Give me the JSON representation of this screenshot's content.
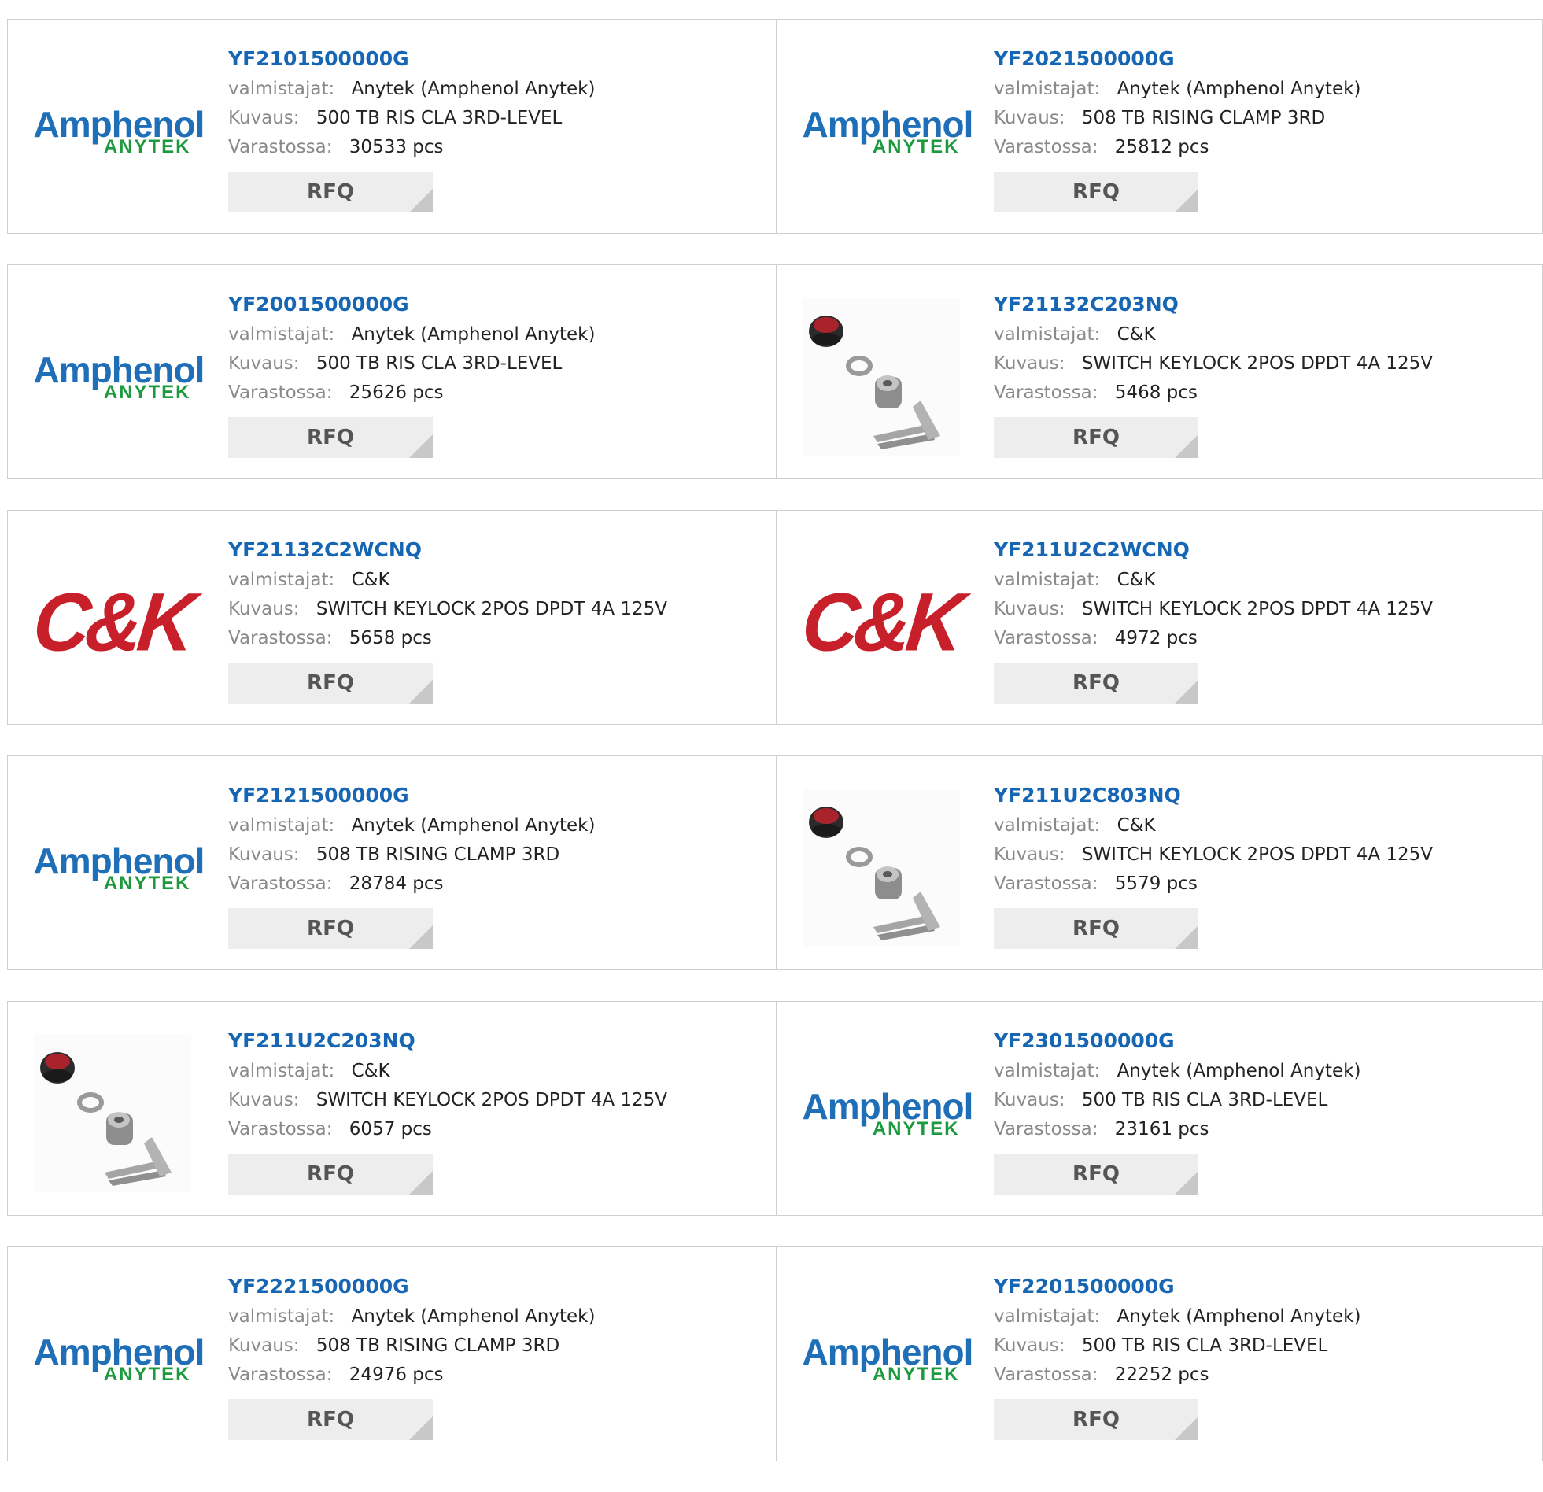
{
  "labels": {
    "manufacturer": "valmistajat:",
    "description": "Kuvaus:",
    "stock": "Varastossa:",
    "rfq": "RFQ"
  },
  "brands": {
    "amphenol": {
      "top": "Amphenol",
      "bottom": "ANYTEK"
    },
    "ck": {
      "text": "C&K"
    }
  },
  "colors": {
    "part_link": "#1766b4",
    "amphenol_blue": "#1f6fb8",
    "anytek_green": "#1d9a3e",
    "ck_red": "#c8202b",
    "rfq_bg": "#ededed"
  },
  "products": [
    {
      "part": "YF2101500000G",
      "manufacturer": "Anytek (Amphenol Anytek)",
      "description": "500 TB RIS CLA 3RD-LEVEL",
      "stock": "30533 pcs",
      "image": "amphenol-logo"
    },
    {
      "part": "YF2021500000G",
      "manufacturer": "Anytek (Amphenol Anytek)",
      "description": "508 TB RISING CLAMP 3RD",
      "stock": "25812 pcs",
      "image": "amphenol-logo"
    },
    {
      "part": "YF2001500000G",
      "manufacturer": "Anytek (Amphenol Anytek)",
      "description": "500 TB RIS CLA 3RD-LEVEL",
      "stock": "25626 pcs",
      "image": "amphenol-logo"
    },
    {
      "part": "YF21132C203NQ",
      "manufacturer": "C&K",
      "description": "SWITCH KEYLOCK 2POS DPDT 4A 125V",
      "stock": "5468 pcs",
      "image": "keylock-photo"
    },
    {
      "part": "YF21132C2WCNQ",
      "manufacturer": "C&K",
      "description": "SWITCH KEYLOCK 2POS DPDT 4A 125V",
      "stock": "5658 pcs",
      "image": "ck-logo"
    },
    {
      "part": "YF211U2C2WCNQ",
      "manufacturer": "C&K",
      "description": "SWITCH KEYLOCK 2POS DPDT 4A 125V",
      "stock": "4972 pcs",
      "image": "ck-logo"
    },
    {
      "part": "YF2121500000G",
      "manufacturer": "Anytek (Amphenol Anytek)",
      "description": "508 TB RISING CLAMP 3RD",
      "stock": "28784 pcs",
      "image": "amphenol-logo"
    },
    {
      "part": "YF211U2C803NQ",
      "manufacturer": "C&K",
      "description": "SWITCH KEYLOCK 2POS DPDT 4A 125V",
      "stock": "5579 pcs",
      "image": "keylock-photo"
    },
    {
      "part": "YF211U2C203NQ",
      "manufacturer": "C&K",
      "description": "SWITCH KEYLOCK 2POS DPDT 4A 125V",
      "stock": "6057 pcs",
      "image": "keylock-photo"
    },
    {
      "part": "YF2301500000G",
      "manufacturer": "Anytek (Amphenol Anytek)",
      "description": "500 TB RIS CLA 3RD-LEVEL",
      "stock": "23161 pcs",
      "image": "amphenol-logo"
    },
    {
      "part": "YF2221500000G",
      "manufacturer": "Anytek (Amphenol Anytek)",
      "description": "508 TB RISING CLAMP 3RD",
      "stock": "24976 pcs",
      "image": "amphenol-logo"
    },
    {
      "part": "YF2201500000G",
      "manufacturer": "Anytek (Amphenol Anytek)",
      "description": "500 TB RIS CLA 3RD-LEVEL",
      "stock": "22252 pcs",
      "image": "amphenol-logo"
    }
  ]
}
